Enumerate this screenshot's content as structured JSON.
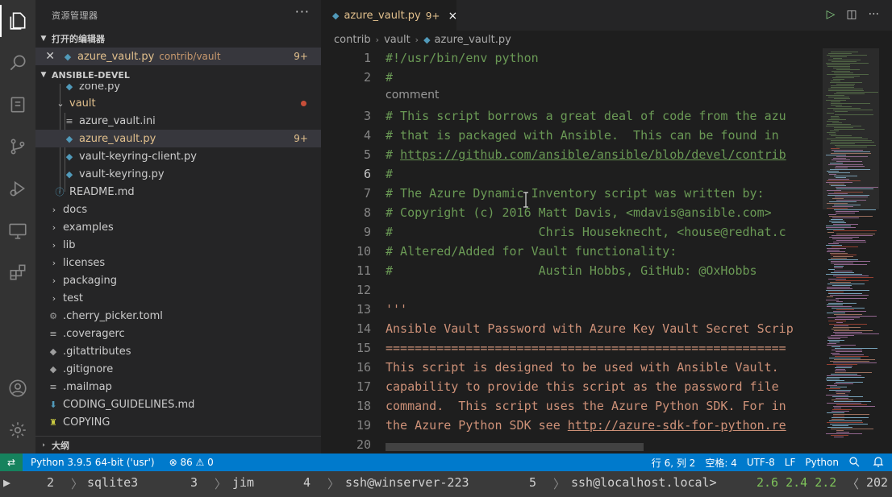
{
  "explorer": {
    "title": "资源管理器",
    "more": "···",
    "open_editors_header": "打开的编辑器",
    "open_editor": {
      "name": "azure_vault.py",
      "path": "contrib/vault",
      "badge": "9+"
    },
    "project_header": "ANSIBLE-DEVEL",
    "items": [
      {
        "label": "zone.py"
      },
      {
        "label": "vault"
      },
      {
        "label": "azure_vault.ini"
      },
      {
        "label": "azure_vault.py",
        "badge": "9+"
      },
      {
        "label": "vault-keyring-client.py"
      },
      {
        "label": "vault-keyring.py"
      },
      {
        "label": "README.md"
      },
      {
        "label": "docs"
      },
      {
        "label": "examples"
      },
      {
        "label": "lib"
      },
      {
        "label": "licenses"
      },
      {
        "label": "packaging"
      },
      {
        "label": "test"
      },
      {
        "label": ".cherry_picker.toml"
      },
      {
        "label": ".coveragerc"
      },
      {
        "label": ".gitattributes"
      },
      {
        "label": ".gitignore"
      },
      {
        "label": ".mailmap"
      },
      {
        "label": "CODING_GUIDELINES.md"
      },
      {
        "label": "COPYING"
      }
    ],
    "outline_header": "大纲"
  },
  "tab": {
    "label": "azure_vault.py",
    "badge": "9+",
    "close": "×"
  },
  "editor_actions": {
    "run": "▷",
    "split": "◫",
    "more": "···"
  },
  "breadcrumb": [
    "contrib",
    "vault",
    "azure_vault.py"
  ],
  "editor": {
    "codelens": "comment",
    "lines": [
      {
        "n": "1",
        "text": "#!/usr/bin/env python"
      },
      {
        "n": "2",
        "text": "#"
      },
      {
        "n": "3",
        "text": "# This script borrows a great deal of code from the azu"
      },
      {
        "n": "4",
        "text": "# that is packaged with Ansible.  This can be found in"
      },
      {
        "n": "5",
        "prefix": "# ",
        "link": "https://github.com/ansible/ansible/blob/devel/contrib"
      },
      {
        "n": "6",
        "text": "#"
      },
      {
        "n": "7",
        "text": "# The Azure Dynamic Inventory script was written by:"
      },
      {
        "n": "8",
        "text": "# Copyright (c) 2016 Matt Davis, <mdavis@ansible.com>"
      },
      {
        "n": "9",
        "text": "#                    Chris Houseknecht, <house@redhat.c"
      },
      {
        "n": "10",
        "text": "# Altered/Added for Vault functionality:"
      },
      {
        "n": "11",
        "text": "#                    Austin Hobbs, GitHub: @OxHobbs"
      },
      {
        "n": "12",
        "text": ""
      },
      {
        "n": "13",
        "text": "'''"
      },
      {
        "n": "14",
        "text": "Ansible Vault Password with Azure Key Vault Secret Scrip"
      },
      {
        "n": "15",
        "text": "======================================================="
      },
      {
        "n": "16",
        "text": "This script is designed to be used with Ansible Vault."
      },
      {
        "n": "17",
        "text": "capability to provide this script as the password file"
      },
      {
        "n": "18",
        "text": "command.  This script uses the Azure Python SDK. For in"
      },
      {
        "n": "19",
        "prefix": "the Azure Python SDK see ",
        "link": "http://azure-sdk-for-python.re"
      },
      {
        "n": "20",
        "text": ""
      }
    ]
  },
  "statusbar": {
    "remote": "⇄",
    "python": "Python 3.9.5 64-bit ('usr')",
    "problems": "⊗ 86 ⚠ 0",
    "position": "行 6, 列 2",
    "spaces": "空格: 4",
    "encoding": "UTF-8",
    "eol": "LF",
    "language": "Python"
  },
  "tmux": {
    "windows": [
      {
        "num": "2",
        "name": "sqlite3"
      },
      {
        "num": "3",
        "name": "jim"
      },
      {
        "num": "4",
        "name": "ssh@winserver-223"
      },
      {
        "num": "5",
        "name": "ssh@localhost.local>"
      }
    ],
    "load": "2.6 2.4 2.2",
    "year": "202"
  },
  "colors": {
    "activitybar": "#333333",
    "sidebar": "#252526",
    "editor": "#1e1e1e",
    "statusbar": "#007acc",
    "comment": "#6a9955",
    "string": "#ce9178",
    "modified": "#e2c08d"
  }
}
